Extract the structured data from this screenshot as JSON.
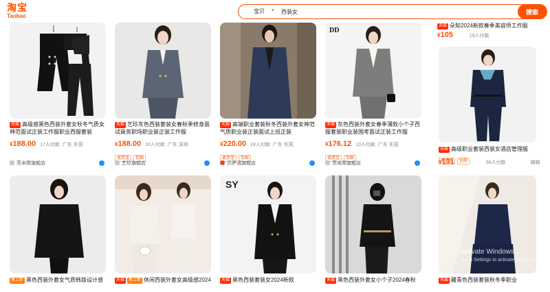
{
  "header": {
    "logo_cn": "淘宝",
    "logo_en": "Taobao",
    "search_type": "宝贝",
    "search_query": "西装女",
    "search_button": "搜索"
  },
  "products": [
    {
      "tags": [
        "天猫"
      ],
      "title": "高级感黑色西装外套女秋冬气质女神范面试正装工作服职业西服套装",
      "price": "188.00",
      "sold": "17人付款",
      "location": "广东  东莞",
      "badges": [],
      "shop": "亮米摩旗舰店"
    },
    {
      "tags": [
        "天猫"
      ],
      "title": "艺珍灰色西装套装女春秋季修身面试商务职场职业装正装工作服",
      "price": "188.00",
      "sold": "16人付款",
      "location": "广东  深圳",
      "badges": [
        "退货宝",
        "包邮"
      ],
      "shop": "艺珍旗舰店"
    },
    {
      "tags": [
        "天猫"
      ],
      "title": "高端职业套装秋冬西装外套女神范气质职业装正装面试上班正装",
      "price": "220.00",
      "sold": "24人付款",
      "location": "广东  东莞",
      "badges": [
        "退货宝",
        "包邮"
      ],
      "shop": "贝萨语旗舰店"
    },
    {
      "tags": [
        "天猫"
      ],
      "title": "灰色西装外套女春季薄款小个子西服套装职业装国考面试正装工作服",
      "price": "176.12",
      "sold": "10人付款",
      "location": "广东  东莞",
      "badges": [
        "退货宝",
        "包邮"
      ],
      "shop": "亮米摩旗舰店"
    },
    {
      "tags": [
        "天猫"
      ],
      "title": "朵知2024新款春季美容师工作服",
      "price": "105",
      "sold": "19人付款",
      "location": "",
      "badges": [],
      "shop": ""
    },
    {
      "tags": [
        "天猫"
      ],
      "title": "高级职业套装西装女酒店管理服",
      "price": "131",
      "sold": "66人付款",
      "location": "",
      "badges": [
        "退货宝",
        "包邮"
      ],
      "shop": "蝴蝶"
    },
    {
      "tags": [
        "春上新"
      ],
      "title": "黑色西装外套女气质韩版设计感",
      "price": "",
      "sold": "",
      "location": "",
      "badges": [],
      "shop": ""
    },
    {
      "tags": [
        "天猫",
        "春上新"
      ],
      "title": "休闲西装外套女高级感2024夏季",
      "price": "",
      "sold": "",
      "location": "",
      "badges": [],
      "shop": ""
    },
    {
      "tags": [
        "天猫"
      ],
      "title": "黑色西装套装女2024新款",
      "price": "",
      "sold": "",
      "location": "",
      "badges": [],
      "shop": ""
    },
    {
      "tags": [
        "天猫"
      ],
      "title": "黑色西装外套女小个子2024春秋",
      "price": "",
      "sold": "",
      "location": "",
      "badges": [],
      "shop": ""
    },
    {
      "tags": [
        "天猫"
      ],
      "title": "藏青色西装套装秋冬季职业",
      "price": "",
      "sold": "",
      "location": "",
      "badges": [],
      "shop": ""
    }
  ],
  "brand_marks": {
    "card3": "DD",
    "card8": "SY"
  },
  "price_symbol": "¥",
  "watermark": {
    "line1": "Activate Windows",
    "line2": "Go to Settings to activate Windows."
  },
  "colors": {
    "accent": "#ff5000",
    "tmall_red": "#ff2a00"
  }
}
